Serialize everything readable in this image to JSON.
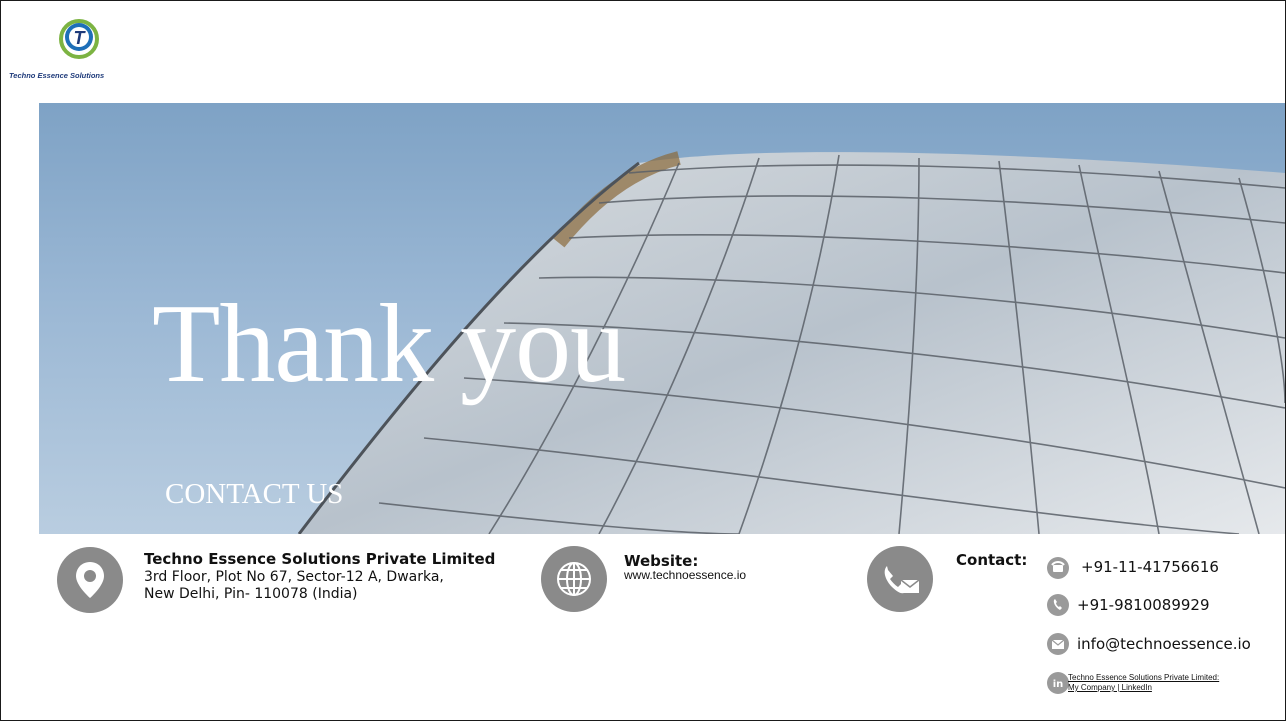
{
  "brand": {
    "logo_letter": "T",
    "name": "Techno Essence Solutions"
  },
  "hero": {
    "title": "Thank you",
    "subtitle": "CONTACT US"
  },
  "address": {
    "company": "Techno Essence Solutions Private Limited",
    "line1": "3rd Floor, Plot No 67, Sector-12 A, Dwarka,",
    "line2": "New Delhi, Pin- 110078 (India)"
  },
  "website": {
    "label": "Website:",
    "url": "www.technoessence.io"
  },
  "contact": {
    "label": "Contact:",
    "phone1": "+91-11-41756616",
    "phone2": "+91-9810089929",
    "email": "info@technoessence.io",
    "linkedin_line1": "Techno Essence Solutions Private Limited:",
    "linkedin_line2": "My Company | LinkedIn"
  },
  "icons": {
    "address": "location-pin-icon",
    "website": "globe-icon",
    "contact": "phone-mail-icon",
    "phone1": "telephone-icon",
    "phone2": "mobile-phone-icon",
    "email": "envelope-icon",
    "linkedin": "linkedin-icon"
  },
  "colors": {
    "icon_grey": "#8a8a8a",
    "logo_blue": "#1e3a7a",
    "logo_green": "#7cb342",
    "sky": "#9ab7d4"
  }
}
